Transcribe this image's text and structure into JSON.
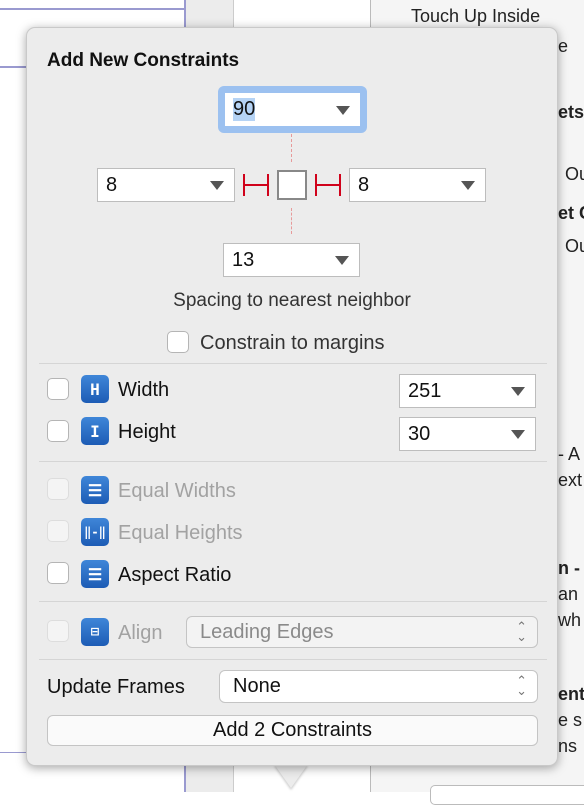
{
  "background": {
    "inspector_fragments": [
      "Touch Up Inside",
      "e",
      "ets",
      "Ou",
      "et C",
      "Ou",
      "- A",
      "ext",
      "n -",
      "an",
      "wh",
      "ent",
      "e s",
      "ns"
    ]
  },
  "popover": {
    "title": "Add New Constraints",
    "spacing": {
      "top": "90",
      "left": "8",
      "right": "8",
      "bottom": "13"
    },
    "spacing_caption": "Spacing to nearest neighbor",
    "constrain_to_margins": {
      "label": "Constrain to margins",
      "checked": false
    },
    "width": {
      "label": "Width",
      "value": "251",
      "checked": false,
      "icon": "width-constraint-icon"
    },
    "height": {
      "label": "Height",
      "value": "30",
      "checked": false,
      "icon": "height-constraint-icon"
    },
    "equal_widths": {
      "label": "Equal Widths",
      "enabled": false,
      "icon": "equal-widths-icon"
    },
    "equal_heights": {
      "label": "Equal Heights",
      "enabled": false,
      "icon": "equal-heights-icon"
    },
    "aspect_ratio": {
      "label": "Aspect Ratio",
      "checked": false,
      "icon": "aspect-ratio-icon"
    },
    "align": {
      "label": "Align",
      "value": "Leading Edges",
      "enabled": false,
      "icon": "align-icon"
    },
    "update_frames": {
      "label": "Update Frames",
      "value": "None"
    },
    "add_button": "Add 2 Constraints",
    "colors": {
      "accent": "#2a6bc9",
      "strut": "#d0021b",
      "focus": "#9cc1f0"
    }
  }
}
